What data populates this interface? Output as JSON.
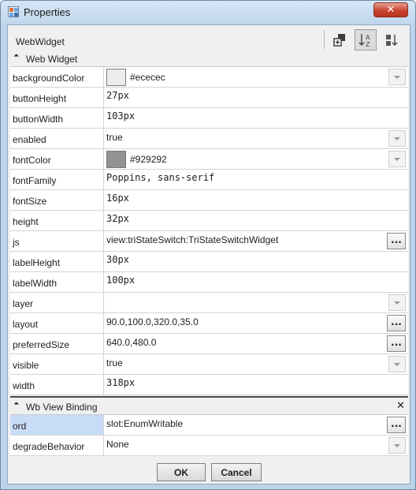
{
  "window": {
    "title": "Properties",
    "close_symbol": "✕"
  },
  "header": {
    "title": "WebWidget"
  },
  "toolbar": {
    "buttons": [
      {
        "icon": "add-slot-icon"
      },
      {
        "icon": "sort-az-icon",
        "pressed": true
      },
      {
        "icon": "sort-order-icon"
      }
    ]
  },
  "sections": [
    {
      "title": "Web Widget",
      "rows": [
        {
          "name": "backgroundColor",
          "value": "#ececec",
          "kind": "color",
          "swatch": "#ececec",
          "control": "dropdown"
        },
        {
          "name": "buttonHeight",
          "value": "27px",
          "kind": "mono"
        },
        {
          "name": "buttonWidth",
          "value": "103px",
          "kind": "mono"
        },
        {
          "name": "enabled",
          "value": "true",
          "kind": "text",
          "control": "dropdown"
        },
        {
          "name": "fontColor",
          "value": "#929292",
          "kind": "color",
          "swatch": "#929292",
          "control": "dropdown"
        },
        {
          "name": "fontFamily",
          "value": "Poppins, sans-serif",
          "kind": "mono"
        },
        {
          "name": "fontSize",
          "value": "16px",
          "kind": "mono"
        },
        {
          "name": "height",
          "value": "32px",
          "kind": "mono"
        },
        {
          "name": "js",
          "value": "view:triStateSwitch:TriStateSwitchWidget",
          "kind": "text",
          "control": "ellipsis"
        },
        {
          "name": "labelHeight",
          "value": "30px",
          "kind": "mono"
        },
        {
          "name": "labelWidth",
          "value": "100px",
          "kind": "mono"
        },
        {
          "name": "layer",
          "value": "",
          "kind": "text",
          "control": "dropdown"
        },
        {
          "name": "layout",
          "value": "90.0,100.0,320.0,35.0",
          "kind": "text",
          "control": "ellipsis"
        },
        {
          "name": "preferredSize",
          "value": "640.0,480.0",
          "kind": "text",
          "control": "ellipsis"
        },
        {
          "name": "visible",
          "value": "true",
          "kind": "text",
          "control": "dropdown"
        },
        {
          "name": "width",
          "value": "318px",
          "kind": "mono"
        }
      ]
    },
    {
      "title": "Wb View Binding",
      "close_symbol": "✕",
      "rows": [
        {
          "name": "ord",
          "value": "slot:EnumWritable",
          "kind": "text",
          "control": "ellipsis",
          "selected": true
        },
        {
          "name": "degradeBehavior",
          "value": "None",
          "kind": "text",
          "control": "dropdown"
        }
      ]
    }
  ],
  "ellipsis_label": "...",
  "collapse_symbol": "⏶",
  "footer": {
    "ok_label": "OK",
    "cancel_label": "Cancel"
  }
}
